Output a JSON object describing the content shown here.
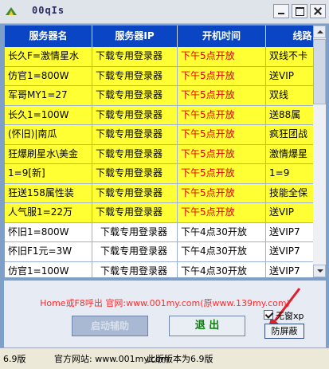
{
  "window": {
    "title": "00qIs"
  },
  "table": {
    "columns": [
      "服务器名",
      "服务器IP",
      "开机时间",
      "线路"
    ],
    "rows": [
      {
        "name": "长久F=激情星水",
        "ip": "下载专用登录器",
        "time": "下午5点开放",
        "line": "双线不卡",
        "style": "yellow"
      },
      {
        "name": "仿官1=800W",
        "ip": "下载专用登录器",
        "time": "下午5点开放",
        "line": "送VIP",
        "style": "yellow"
      },
      {
        "name": "军哥MY1=27",
        "ip": "下载专用登录器",
        "time": "下午5点开放",
        "line": "双线",
        "style": "yellow"
      },
      {
        "name": "长久1=100W",
        "ip": "下载专用登录器",
        "time": "下午5点开放",
        "line": "送88属",
        "style": "yellow"
      },
      {
        "name": "(怀旧)|南瓜",
        "ip": "下载专用登录器",
        "time": "下午5点开放",
        "line": "疯狂团战",
        "style": "yellow"
      },
      {
        "name": "狂爆刷星水\\美金",
        "ip": "下载专用登录器",
        "time": "下午5点开放",
        "line": "激情爆星",
        "style": "yellow"
      },
      {
        "name": "1=9[新]",
        "ip": "下载专用登录器",
        "time": "下午5点开放",
        "line": "1=9",
        "style": "yellow"
      },
      {
        "name": "狂送158属性装",
        "ip": "下载专用登录器",
        "time": "下午5点开放",
        "line": "技能全保",
        "style": "yellow"
      },
      {
        "name": "人气服1=22万",
        "ip": "下载专用登录器",
        "time": "下午5点开放",
        "line": "送VIP",
        "style": "yellow"
      },
      {
        "name": "怀旧1=800W",
        "ip": "下载专用登录器",
        "time": "下午4点30开放",
        "line": "送VIP7",
        "style": "white"
      },
      {
        "name": "怀旧F1元=3W",
        "ip": "下载专用登录器",
        "time": "下午4点30开放",
        "line": "送VIP7",
        "style": "white"
      },
      {
        "name": "仿官1=100W",
        "ip": "下载专用登录器",
        "time": "下午4点30开放",
        "line": "送VIP7",
        "style": "white"
      }
    ]
  },
  "promo_text": "Home或F8呼出 官网:www.001my.com(原www.139my.com)",
  "buttons": {
    "start": "启动辅助",
    "exit": "退  出",
    "hide": "防屏蔽"
  },
  "checkbox": {
    "label": "无窗xp",
    "checked": true
  },
  "status": {
    "version": "6.9版",
    "site": "官方网站: www.001my.com",
    "note": "此版版本为6.9版"
  },
  "colors": {
    "header": "#0a46c4",
    "highlight_row": "#ffff33",
    "red_text": "#e00000",
    "promo": "#ff2a2a"
  }
}
